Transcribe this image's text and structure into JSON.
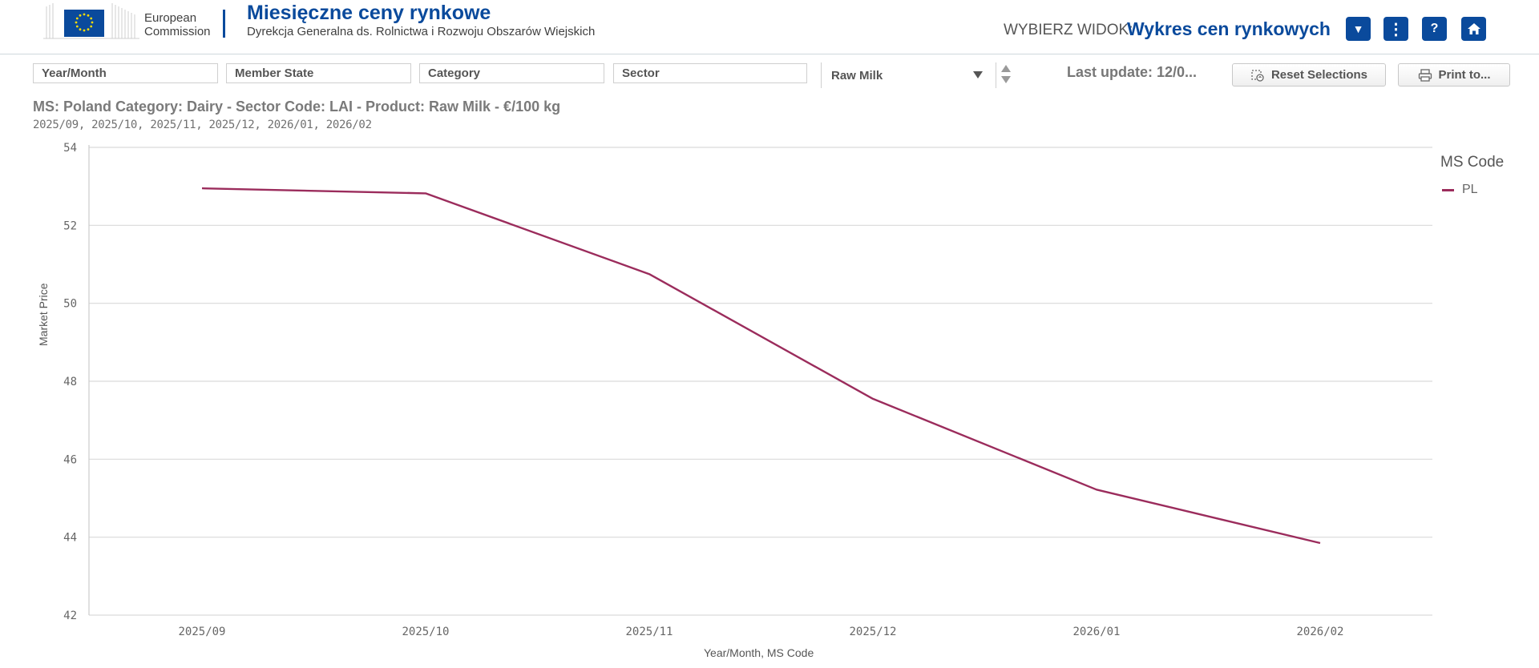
{
  "header": {
    "org_line1": "European",
    "org_line2": "Commission",
    "title": "Miesięczne ceny rynkowe",
    "subtitle": "Dyrekcja Generalna ds. Rolnictwa i Rozwoju Obszarów Wiejskich",
    "view_label": "WYBIERZ WIDOK:",
    "view_value": "Wykres cen rynkowych",
    "buttons": {
      "dropdown": "▼",
      "menu": "⋮",
      "help": "?",
      "home": "home-icon"
    }
  },
  "filters": {
    "year_month": "Year/Month",
    "member_state": "Member State",
    "category": "Category",
    "sector": "Sector",
    "product_selected": "Raw Milk",
    "last_update": "Last update: 12/0...",
    "reset_label": "Reset Selections",
    "print_label": "Print to..."
  },
  "chart": {
    "title": "MS: Poland Category: Dairy - Sector Code: LAI - Product: Raw Milk - €/100 kg",
    "subtitle": "2025/09, 2025/10, 2025/11, 2025/12, 2026/01, 2026/02",
    "legend_title": "MS Code",
    "series_color": "#9b2c5c"
  },
  "chart_data": {
    "type": "line",
    "categories": [
      "2025/09",
      "2025/10",
      "2025/11",
      "2025/12",
      "2026/01",
      "2026/02"
    ],
    "series": [
      {
        "name": "PL",
        "values": [
          52.95,
          52.82,
          50.75,
          47.55,
          45.22,
          43.85
        ]
      }
    ],
    "xlabel": "Year/Month, MS Code",
    "ylabel": "Market Price",
    "ylim": [
      42,
      54
    ],
    "yticks": [
      "42",
      "44",
      "46",
      "48",
      "50",
      "52",
      "54"
    ],
    "grid": true,
    "legend_position": "right"
  }
}
